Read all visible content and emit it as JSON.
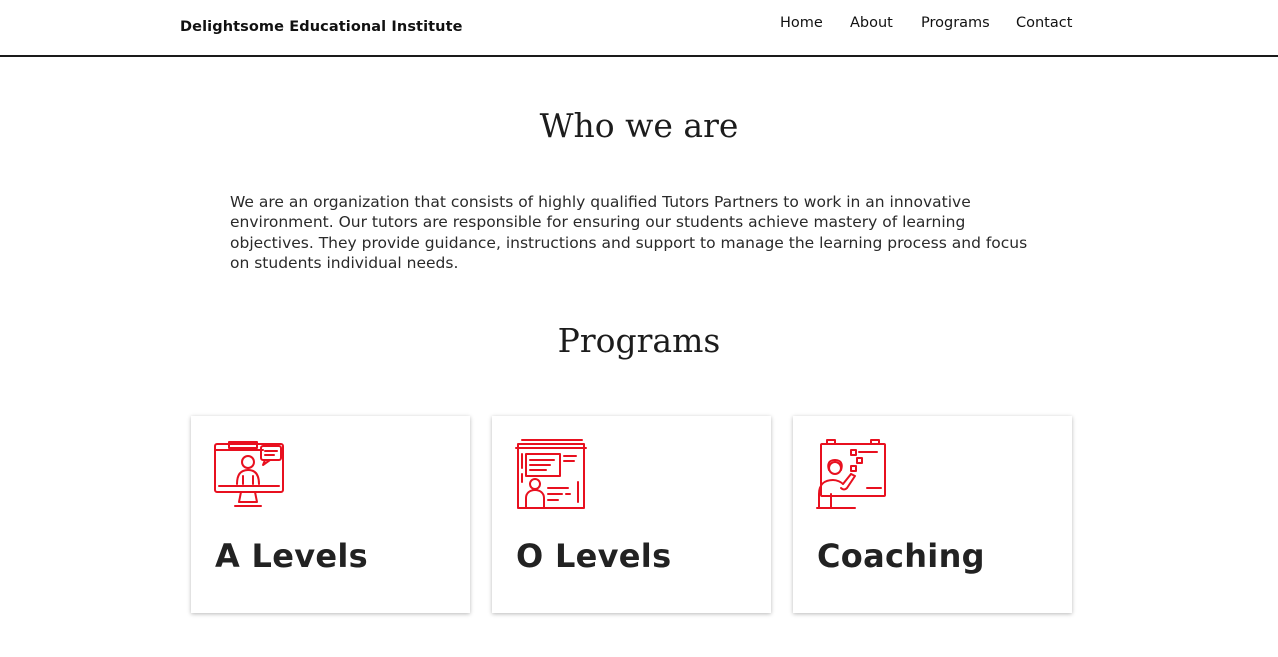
{
  "navbar": {
    "brand": "Delightsome Educational Institute",
    "links": [
      {
        "label": "Home"
      },
      {
        "label": "About"
      },
      {
        "label": "Programs"
      },
      {
        "label": "Contact"
      }
    ]
  },
  "about": {
    "title": "Who we are",
    "body": "We are an organization that consists of highly qualified Tutors Partners to work in an innovative environment. Our tutors are responsible for ensuring our students achieve mastery of learning objectives. They provide guidance, instructions and support to manage the learning process and focus on students individual needs."
  },
  "programs": {
    "title": "Programs",
    "cards": [
      {
        "title": "A Levels",
        "icon": "online-tutor-monitor-icon"
      },
      {
        "title": "O Levels",
        "icon": "classroom-board-icon"
      },
      {
        "title": "Coaching",
        "icon": "presenter-whiteboard-icon"
      }
    ]
  },
  "colors": {
    "accent": "#e8101f",
    "text": "#222222",
    "navbar_border": "#1a1a1a"
  }
}
